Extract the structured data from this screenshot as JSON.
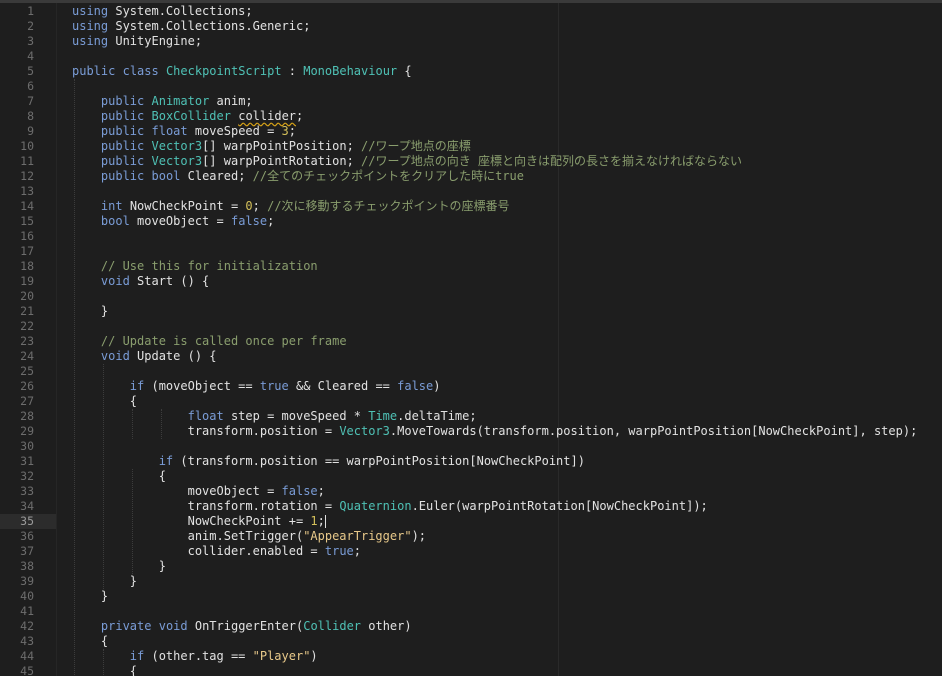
{
  "editor": {
    "current_line": 35,
    "lines": [
      {
        "n": "1",
        "t": "using System.Collections;"
      },
      {
        "n": "2",
        "t": "using System.Collections.Generic;"
      },
      {
        "n": "3",
        "t": "using UnityEngine;"
      },
      {
        "n": "4",
        "t": ""
      },
      {
        "n": "5",
        "t": "public class CheckpointScript : MonoBehaviour {"
      },
      {
        "n": "6",
        "t": ""
      },
      {
        "n": "7",
        "t": "    public Animator anim;"
      },
      {
        "n": "8",
        "t": "    public BoxCollider collider;"
      },
      {
        "n": "9",
        "t": "    public float moveSpeed = 3;"
      },
      {
        "n": "10",
        "t": "    public Vector3[] warpPointPosition; //ワープ地点の座標"
      },
      {
        "n": "11",
        "t": "    public Vector3[] warpPointRotation; //ワープ地点の向き 座標と向きは配列の長さを揃えなければならない"
      },
      {
        "n": "12",
        "t": "    public bool Cleared; //全てのチェックポイントをクリアした時にtrue"
      },
      {
        "n": "13",
        "t": ""
      },
      {
        "n": "14",
        "t": "    int NowCheckPoint = 0; //次に移動するチェックポイントの座標番号"
      },
      {
        "n": "15",
        "t": "    bool moveObject = false;"
      },
      {
        "n": "16",
        "t": ""
      },
      {
        "n": "17",
        "t": ""
      },
      {
        "n": "18",
        "t": "    // Use this for initialization"
      },
      {
        "n": "19",
        "t": "    void Start () {"
      },
      {
        "n": "20",
        "t": ""
      },
      {
        "n": "21",
        "t": "    }"
      },
      {
        "n": "22",
        "t": ""
      },
      {
        "n": "23",
        "t": "    // Update is called once per frame"
      },
      {
        "n": "24",
        "t": "    void Update () {"
      },
      {
        "n": "25",
        "t": ""
      },
      {
        "n": "26",
        "t": "        if (moveObject == true && Cleared == false)"
      },
      {
        "n": "27",
        "t": "        {"
      },
      {
        "n": "28",
        "t": "                float step = moveSpeed * Time.deltaTime;"
      },
      {
        "n": "29",
        "t": "                transform.position = Vector3.MoveTowards(transform.position, warpPointPosition[NowCheckPoint], step);"
      },
      {
        "n": "30",
        "t": ""
      },
      {
        "n": "31",
        "t": "            if (transform.position == warpPointPosition[NowCheckPoint])"
      },
      {
        "n": "32",
        "t": "            {"
      },
      {
        "n": "33",
        "t": "                moveObject = false;"
      },
      {
        "n": "34",
        "t": "                transform.rotation = Quaternion.Euler(warpPointRotation[NowCheckPoint]);"
      },
      {
        "n": "35",
        "t": "                NowCheckPoint += 1;"
      },
      {
        "n": "36",
        "t": "                anim.SetTrigger(\"AppearTrigger\");"
      },
      {
        "n": "37",
        "t": "                collider.enabled = true;"
      },
      {
        "n": "38",
        "t": "            }"
      },
      {
        "n": "39",
        "t": "        }"
      },
      {
        "n": "40",
        "t": "    }"
      },
      {
        "n": "41",
        "t": ""
      },
      {
        "n": "42",
        "t": "    private void OnTriggerEnter(Collider other)"
      },
      {
        "n": "43",
        "t": "    {"
      },
      {
        "n": "44",
        "t": "        if (other.tag == \"Player\")"
      },
      {
        "n": "45",
        "t": "        {"
      }
    ]
  },
  "colors": {
    "background": "#1e1e1e",
    "keyword": "#7a9cd6",
    "type": "#4fc1b5",
    "number": "#d4c05a",
    "string": "#e8c98a",
    "comment": "#8a9e6e",
    "text": "#e2e2e2",
    "gutter_text": "#6d6d6d"
  }
}
